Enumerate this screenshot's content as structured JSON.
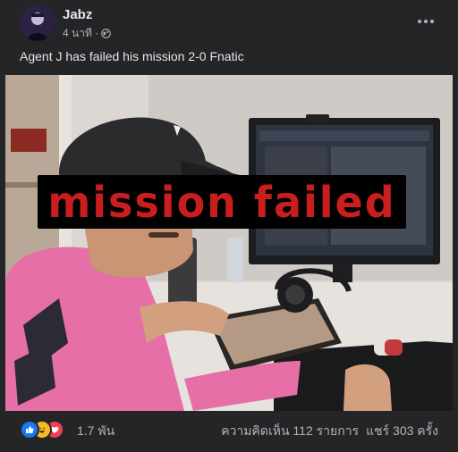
{
  "post": {
    "author": "Jabz",
    "time": "4 นาที ·",
    "caption": "Agent J has failed his mission 2-0 Fnatic",
    "overlay_text": "mission failed",
    "reactions": [
      "like",
      "haha",
      "love"
    ],
    "reaction_count": "1.7 พัน",
    "comments": "ความคิดเห็น 112 รายการ",
    "shares": "แชร์ 303 ครั้ง"
  },
  "colors": {
    "background": "#242526",
    "primary_text": "#e4e6eb",
    "secondary_text": "#b0b3b8",
    "overlay_red": "#c81e1e"
  }
}
